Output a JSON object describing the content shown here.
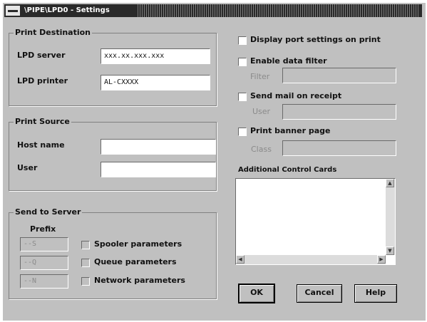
{
  "window": {
    "title": "\\PIPE\\LPD0 - Settings"
  },
  "print_destination": {
    "legend": "Print Destination",
    "lpd_server_label": "LPD server",
    "lpd_server_value": "xxx.xx.xxx.xxx",
    "lpd_printer_label": "LPD printer",
    "lpd_printer_value": "AL-CXXXX"
  },
  "print_source": {
    "legend": "Print Source",
    "host_name_label": "Host name",
    "host_name_value": "",
    "user_label": "User",
    "user_value": ""
  },
  "send_to_server": {
    "legend": "Send to Server",
    "prefix_label": "Prefix",
    "prefix_s": "--S",
    "prefix_q": "--Q",
    "prefix_n": "--N",
    "spooler_label": "Spooler parameters",
    "queue_label": "Queue parameters",
    "network_label": "Network parameters"
  },
  "options": {
    "display_port_label": "Display port settings on print",
    "enable_filter_label": "Enable data filter",
    "filter_label": "Filter",
    "filter_value": "",
    "send_mail_label": "Send mail on receipt",
    "mail_user_label": "User",
    "mail_user_value": "",
    "banner_label": "Print banner page",
    "class_label": "Class",
    "class_value": "",
    "control_cards_label": "Additional Control Cards",
    "control_cards_value": ""
  },
  "buttons": {
    "ok": "OK",
    "cancel": "Cancel",
    "help": "Help"
  }
}
